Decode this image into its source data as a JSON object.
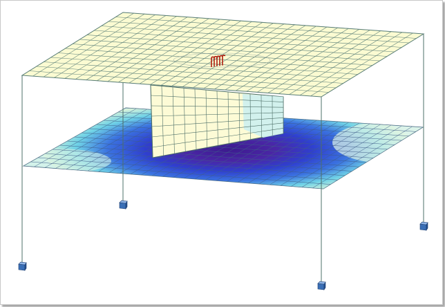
{
  "scene": {
    "description_visible_text": "",
    "colors": {
      "background": "#ffffff",
      "top_slab_fill": "#fbfbd2",
      "top_slab_grid": "#5b7f78",
      "wall_fill": "#fdfbd6",
      "wall_grid": "#4c6e66",
      "column_line": "#4c7069",
      "support_block": "#3a6fb6",
      "load_arrows": "#b01e10",
      "contour_high": "#f6f9cf",
      "contour_mid": "#6fd2e6",
      "contour_low_blue": "#2a54d6",
      "contour_deep": "#3c1a8e"
    },
    "elements": {
      "top_slab": {
        "label": "top-slab"
      },
      "bottom_slab": {
        "label": "bottom-slab-contour"
      },
      "shear_wall": {
        "label": "shear-wall"
      },
      "columns": {
        "count": 4
      },
      "supports": {
        "count": 4
      },
      "load_arrows": {
        "count": 5
      }
    }
  }
}
